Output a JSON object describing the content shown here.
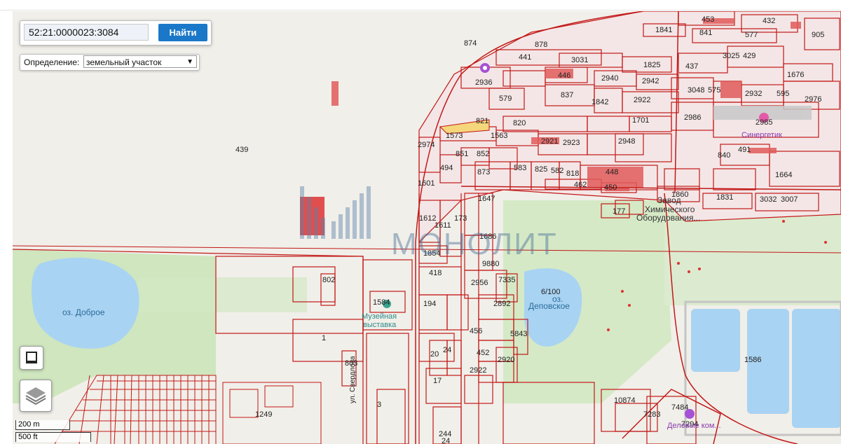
{
  "search": {
    "value": "52:21:0000023:3084",
    "button_label": "Найти"
  },
  "definition": {
    "label": "Определение:",
    "selected": "земельный участок"
  },
  "watermark": "МОНОЛИТ",
  "scale": {
    "metric": "200 m",
    "imperial": "500 ft"
  },
  "places": {
    "lake_dobroe": "оз. Доброе",
    "lake_depovskoe": "Деповское",
    "lake_depovskoe_prefix": "оз.",
    "museum_line1": "Музейная",
    "museum_line2": "выставка",
    "plant_line1": "Завод",
    "plant_line2": "Химического",
    "plant_line3": "Оборудования...",
    "sinergetik": "Синергетик",
    "sverdlova": "ул. Свердлова",
    "depovskoe_poi": "Деловые ком..."
  },
  "parcels": [
    "453",
    "432",
    "1841",
    "841",
    "577",
    "905",
    "874",
    "878",
    "441",
    "3031",
    "1825",
    "437",
    "3025",
    "429",
    "1676",
    "2936",
    "446",
    "2940",
    "2942",
    "3048",
    "575",
    "2932",
    "595",
    "2976",
    "579",
    "837",
    "1842",
    "2922",
    "821",
    "820",
    "1701",
    "2986",
    "2985",
    "1573",
    "1563",
    "2974",
    "2921",
    "2923",
    "2948",
    "851",
    "852",
    "840",
    "491",
    "494",
    "873",
    "583",
    "825",
    "582",
    "818",
    "448",
    "1664",
    "1601",
    "462",
    "450",
    "1860",
    "1831",
    "3032",
    "3007",
    "177",
    "439",
    "1612",
    "1647",
    "1611",
    "173",
    "1686",
    "1854",
    "9880",
    "418",
    "802",
    "2956",
    "7335",
    "6/100",
    "1584",
    "194",
    "2892",
    "456",
    "1",
    "5843",
    "452",
    "20",
    "24",
    "2920",
    "803",
    "2922",
    "17",
    "1586",
    "3",
    "1249",
    "10874",
    "7283",
    "7484",
    "7294",
    "244",
    "24"
  ]
}
